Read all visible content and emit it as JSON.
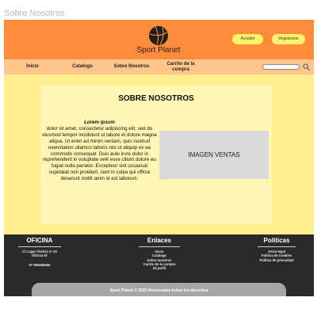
{
  "frame": {
    "label": "Sobre Nosotros"
  },
  "header": {
    "brand": "Sport Planet",
    "login_label": "Acceder",
    "register_label": "Registrarse"
  },
  "nav": {
    "items": [
      "Inicio",
      "Catalogo",
      "Sobre Nosotros",
      "Carrito de la compra"
    ],
    "search": {
      "value": "",
      "placeholder": ""
    }
  },
  "main": {
    "title": "SOBRE NOSOTROS",
    "text_heading": "Lorem ipsum",
    "text_body": "dolor sit amet, consectetur adipiscing elit, sed do eiusmod tempor incididunt ut labore et dolore magna aliqua. Ut enim ad minim veniam, quis nostrud exercitation ullamco laboris nisi ut aliquip ex ea commodo consequat. Duis aute irure dolor in reprehenderit in voluptate velit esse cillum dolore eu fugiat nulla pariatur. Excepteur sint occaecat cupidatat non proident, sunt in culpa qui officia deserunt mollit anim id est laborum.",
    "image_label": "IMAGEN VENTAS"
  },
  "footer": {
    "office": {
      "title": "OFICINA",
      "address": "C/ Lugar Ficticio nº 20",
      "office_number": "Oficina 67",
      "phone": "Nº 666666666"
    },
    "links": {
      "title": "Enlaces",
      "items": [
        "Inicio",
        "Catalogo",
        "Sobre nosotros",
        "Carrito de la compra",
        "Mi perfil"
      ]
    },
    "policies": {
      "title": "Políticas",
      "items": [
        "Aviso legal",
        "Política de Cookies",
        "Política de privacidad"
      ]
    },
    "copyright": "Sport Planet © 2023 Reservados todos los derechos"
  },
  "colors": {
    "header": "#ff8c3a",
    "nav": "#ffc58d",
    "page_background": "#ffee8c",
    "content_panel": "#fff7b3",
    "buttons": "#fff36b",
    "footer": "#2a2a2a",
    "copyright_bar": "#a6a6a6"
  },
  "icons": {
    "logo": "basketball-icon",
    "search": "search-icon"
  }
}
